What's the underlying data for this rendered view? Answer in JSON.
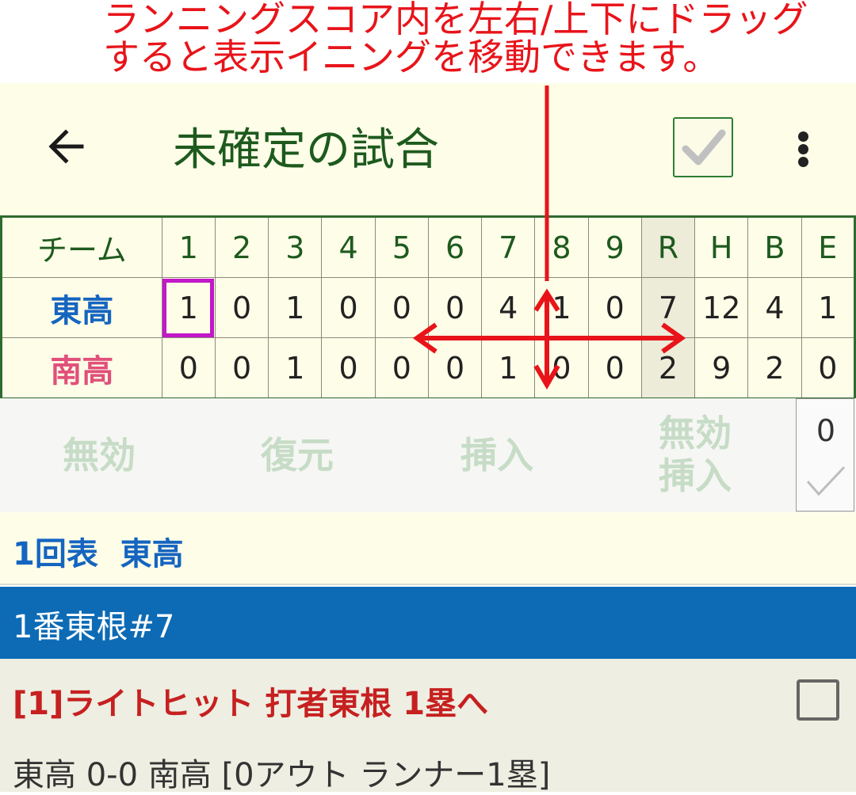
{
  "annotation": {
    "line1": "ランニングスコア内を左右/上下にドラッグ",
    "line2": "すると表示イニングを移動できます。",
    "color": "#e8141a"
  },
  "appbar": {
    "back_icon": "arrow-left-icon",
    "title": "未確定の試合",
    "confirm_icon": "check-icon",
    "more_icon": "more-vert-icon"
  },
  "scoreboard": {
    "headers": [
      "チーム",
      "1",
      "2",
      "3",
      "4",
      "5",
      "6",
      "7",
      "8",
      "9",
      "R",
      "H",
      "B",
      "E"
    ],
    "rows": [
      {
        "team": "東高",
        "cells": [
          "1",
          "0",
          "1",
          "0",
          "0",
          "0",
          "4",
          "1",
          "0",
          "7",
          "12",
          "4",
          "1"
        ]
      },
      {
        "team": "南高",
        "cells": [
          "0",
          "0",
          "1",
          "0",
          "0",
          "0",
          "1",
          "0",
          "0",
          "2",
          "9",
          "2",
          "0"
        ]
      }
    ],
    "selected_cell": {
      "row": 0,
      "inning": "1"
    }
  },
  "actions": {
    "invalidate": "無効",
    "restore": "復元",
    "insert": "挿入",
    "invalid_insert_line1": "無効",
    "invalid_insert_line2": "挿入",
    "counter": "0"
  },
  "inning": {
    "label": "1回表  東高"
  },
  "batter": {
    "label": "1番東根#7"
  },
  "play": {
    "label": "[1]ライトヒット 打者東根 1塁へ",
    "status": "東高 0-0 南高 [0アウト ランナー1塁]"
  },
  "colors": {
    "accent_green": "#1e5a1e",
    "team_east": "#1565c0",
    "team_south": "#e0507a",
    "batter_bar": "#0d6bb5",
    "play_text": "#c62020"
  }
}
